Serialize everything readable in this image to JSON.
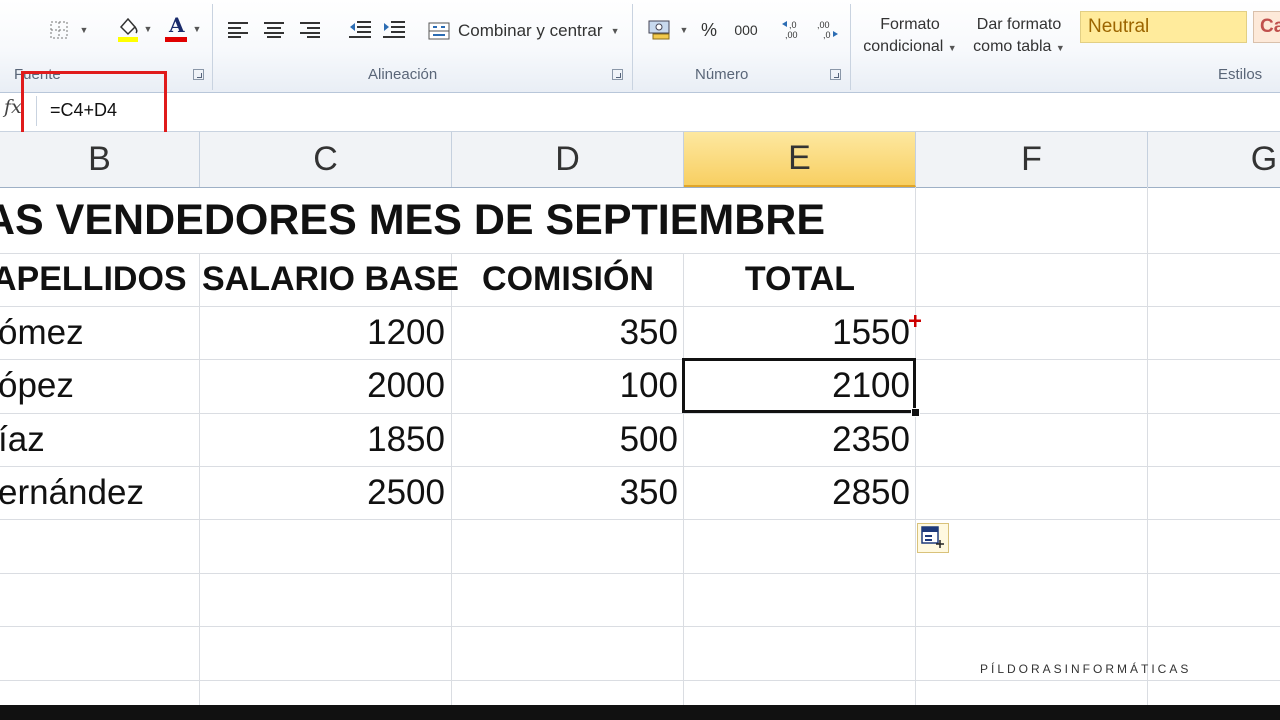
{
  "ribbon": {
    "groups": {
      "fuente": "Fuente",
      "alineacion": "Alineación",
      "numero": "Número",
      "estilos": "Estilos"
    },
    "alignment": {
      "merge_label": "Combinar y centrar"
    },
    "number": {
      "percent": "%",
      "thousands": "000"
    },
    "styles": {
      "conditional_line1": "Formato",
      "conditional_line2": "condicional",
      "table_line1": "Dar formato",
      "table_line2": "como tabla",
      "neutral_label": "Neutral",
      "next_style": "Ca"
    },
    "colors": {
      "highlight": "#ffff00",
      "font_color": "#e00000"
    }
  },
  "formula_bar": {
    "fx_label": "fx",
    "formula": "=C4+D4"
  },
  "columns": [
    {
      "name": "B"
    },
    {
      "name": "C"
    },
    {
      "name": "D"
    },
    {
      "name": "E",
      "selected": true
    },
    {
      "name": "F"
    },
    {
      "name": "G"
    }
  ],
  "sheet": {
    "title": "AS VENDEDORES MES DE SEPTIEMBRE",
    "headers": {
      "apellidos": "APELLIDOS",
      "salario": "SALARIO BASE",
      "comision": "COMISIÓN",
      "total": "TOTAL"
    },
    "rows": [
      {
        "apellido": "ómez",
        "salario": "1200",
        "comision": "350",
        "total": "1550"
      },
      {
        "apellido": "ópez",
        "salario": "2000",
        "comision": "100",
        "total": "2100"
      },
      {
        "apellido": "íaz",
        "salario": "1850",
        "comision": "500",
        "total": "2350"
      },
      {
        "apellido": "ernández",
        "salario": "2500",
        "comision": "350",
        "total": "2850"
      }
    ],
    "active_cell": "E5"
  },
  "watermark": "PÍLDORASINFORMÁTICAS"
}
